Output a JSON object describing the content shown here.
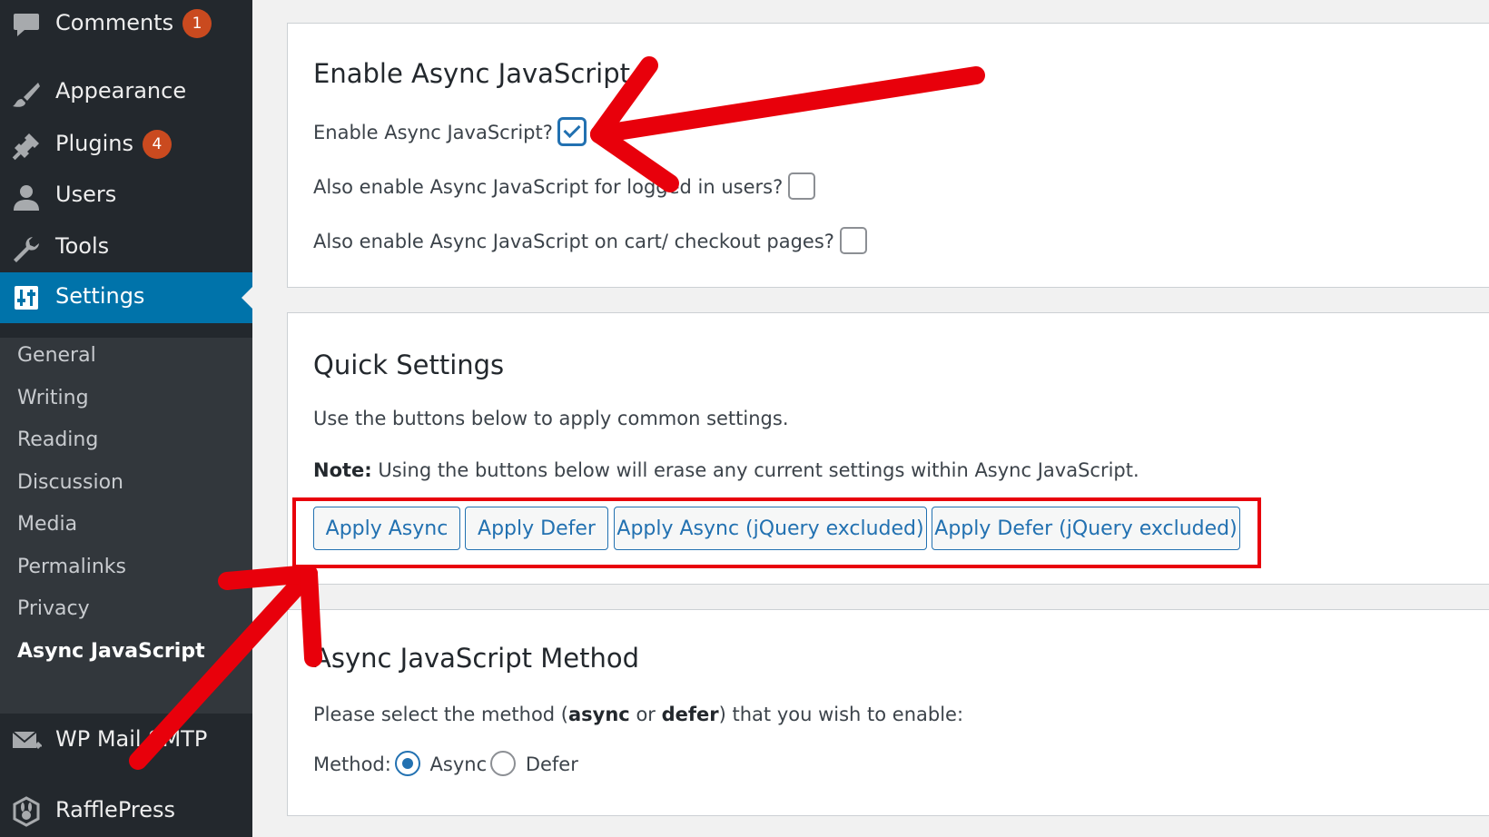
{
  "colors": {
    "sidebar_bg": "#23282d",
    "submenu_bg": "#32373c",
    "active_bg": "#0073aa",
    "badge": "#ca4a1f",
    "button_accent": "#2271b1",
    "annotation_red": "#e8000b"
  },
  "sidebar": {
    "items": [
      {
        "label": "Comments",
        "icon": "comment-icon",
        "badge": "1"
      },
      {
        "label": "Appearance",
        "icon": "paintbrush-icon"
      },
      {
        "label": "Plugins",
        "icon": "plugin-icon",
        "badge": "4"
      },
      {
        "label": "Users",
        "icon": "user-icon"
      },
      {
        "label": "Tools",
        "icon": "wrench-icon"
      },
      {
        "label": "Settings",
        "icon": "settings-icon",
        "active": true
      },
      {
        "label": "WP Mail SMTP",
        "icon": "mail-icon"
      },
      {
        "label": "RafflePress",
        "icon": "rafflepress-icon"
      }
    ],
    "submenu": [
      "General",
      "Writing",
      "Reading",
      "Discussion",
      "Media",
      "Permalinks",
      "Privacy",
      "Async JavaScript"
    ],
    "submenu_current": "Async JavaScript"
  },
  "enable_section": {
    "title": "Enable Async JavaScript",
    "options": [
      {
        "label": "Enable Async JavaScript?",
        "checked": true
      },
      {
        "label": "Also enable Async JavaScript for logged in users?",
        "checked": false
      },
      {
        "label": "Also enable Async JavaScript on cart/ checkout pages?",
        "checked": false
      }
    ]
  },
  "quick_section": {
    "title": "Quick Settings",
    "description": "Use the buttons below to apply common settings.",
    "note_label": "Note:",
    "note_text": " Using the buttons below will erase any current settings within Async JavaScript.",
    "buttons": [
      "Apply Async",
      "Apply Defer",
      "Apply Async (jQuery excluded)",
      "Apply Defer (jQuery excluded)"
    ]
  },
  "method_section": {
    "title": "Async JavaScript Method",
    "desc_1": "Please select the method (",
    "desc_async": "async",
    "desc_or": " or ",
    "desc_defer": "defer",
    "desc_2": ") that you wish to enable:",
    "method_label": "Method:",
    "options": [
      {
        "label": "Async",
        "selected": true
      },
      {
        "label": "Defer",
        "selected": false
      }
    ]
  }
}
